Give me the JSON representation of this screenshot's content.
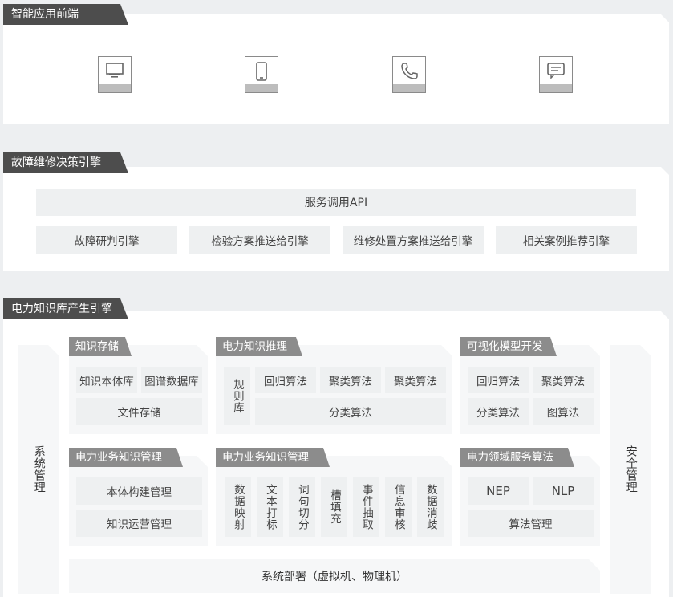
{
  "sections": {
    "frontend": {
      "title": "智能应用前端",
      "icons": [
        "monitor-icon",
        "mobile-phone-icon",
        "telephone-icon",
        "chat-message-icon"
      ]
    },
    "fault": {
      "title": "故障维修决策引擎",
      "api_label": "服务调用API",
      "engines": [
        "故障研判引擎",
        "检验方案推送给引擎",
        "维修处置方案推送给引擎",
        "相关案例推荐引擎"
      ]
    },
    "knowledge": {
      "title": "电力知识库产生引擎",
      "left_bar": "系统管理",
      "right_bar": "安全管理",
      "storage": {
        "title": "知识存储",
        "items": [
          "知识本体库",
          "图谱数据库",
          "文件存储"
        ]
      },
      "reasoning": {
        "title": "电力知识推理",
        "rule_lib": "规则库",
        "items": [
          "回归算法",
          "聚类算法",
          "聚类算法",
          "分类算法"
        ]
      },
      "visual": {
        "title": "可视化模型开发",
        "items": [
          "回归算法",
          "聚类算法",
          "分类算法",
          "图算法"
        ]
      },
      "business_mgmt": {
        "title": "电力业务知识管理",
        "items": [
          "本体构建管理",
          "知识运营管理"
        ]
      },
      "business_proc": {
        "title": "电力业务知识管理",
        "items": [
          "数据映射",
          "文本打标",
          "词句切分",
          "槽填充",
          "事件抽取",
          "信息审核",
          "数据消歧"
        ]
      },
      "domain_alg": {
        "title": "电力领域服务算法",
        "items": [
          "NEP",
          "NLP",
          "算法管理"
        ]
      },
      "deploy": "系统部署（虚拟机、物理机）"
    }
  }
}
